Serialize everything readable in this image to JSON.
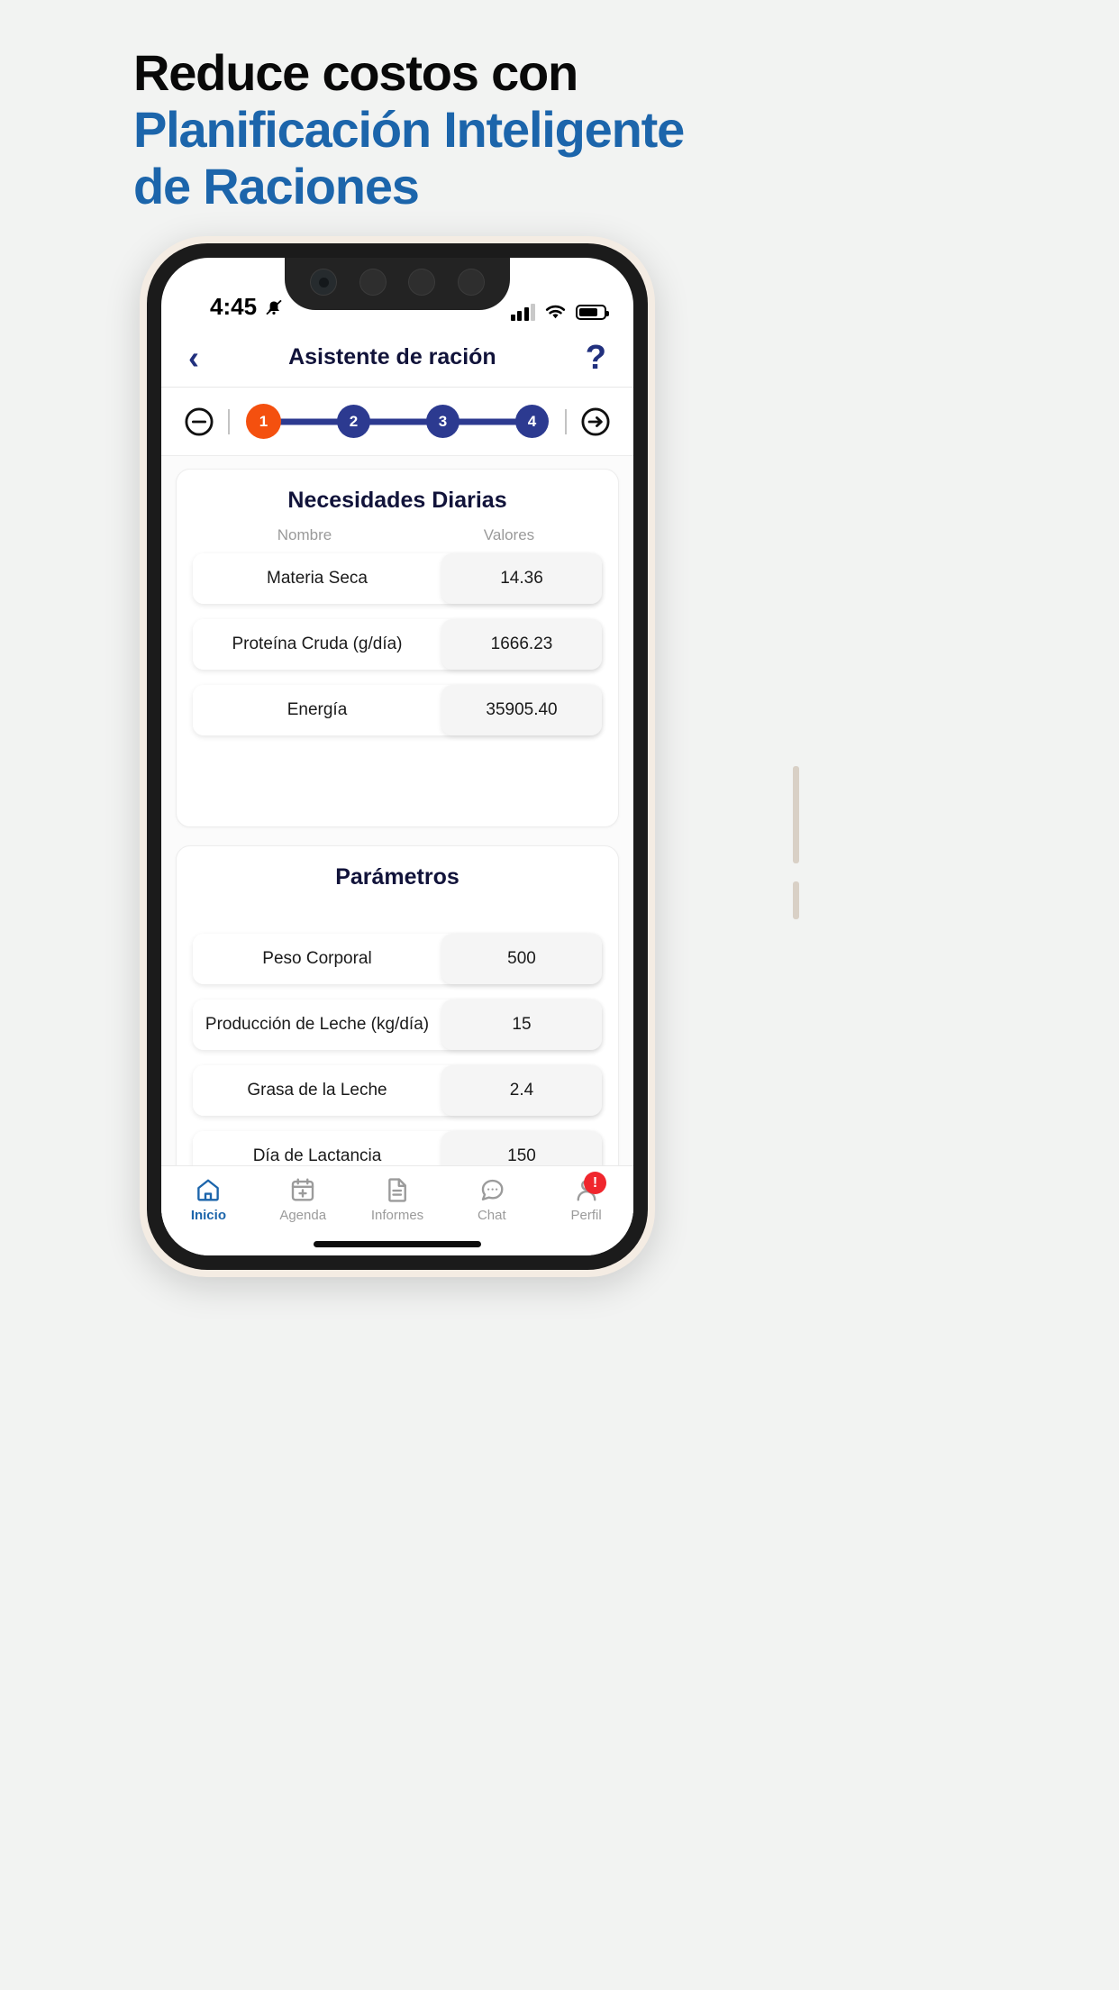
{
  "headline": {
    "line1": "Reduce costos con",
    "line2": "Planificación Inteligente",
    "line3": "de Raciones",
    "color_dark": "#090909",
    "color_accent": "#1c65ab"
  },
  "status_bar": {
    "time": "4:45",
    "silent_icon": "bell-muted-icon",
    "signal_icon": "signal-bars-icon",
    "wifi_icon": "wifi-icon",
    "battery_icon": "battery-icon"
  },
  "app_header": {
    "back_icon": "chevron-left-icon",
    "title": "Asistente de ración",
    "help_icon": "question-mark-icon",
    "title_color": "#11133a"
  },
  "stepper": {
    "minus_icon": "minus-circle-icon",
    "next_icon": "arrow-right-circle-icon",
    "active_color": "#f4500f",
    "step_color": "#2c3a90",
    "steps": [
      {
        "label": "1",
        "active": true
      },
      {
        "label": "2",
        "active": false
      },
      {
        "label": "3",
        "active": false
      },
      {
        "label": "4",
        "active": false
      }
    ]
  },
  "needs_card": {
    "title": "Necesidades Diarias",
    "col_name": "Nombre",
    "col_value": "Valores",
    "rows": [
      {
        "label": "Materia Seca",
        "value": "14.36"
      },
      {
        "label": "Proteína Cruda (g/día)",
        "value": "1666.23"
      },
      {
        "label": "Energía",
        "value": "35905.40"
      }
    ]
  },
  "params_card": {
    "title": "Parámetros",
    "rows": [
      {
        "label": "Peso Corporal",
        "value": "500"
      },
      {
        "label": "Producción de Leche (kg/día)",
        "value": "15"
      },
      {
        "label": "Grasa de la Leche",
        "value": "2.4"
      },
      {
        "label": "Día de Lactancia",
        "value": "150"
      }
    ]
  },
  "bottom_nav": {
    "items": [
      {
        "label": "Inicio",
        "icon": "home-icon",
        "active": true
      },
      {
        "label": "Agenda",
        "icon": "calendar-plus-icon",
        "active": false
      },
      {
        "label": "Informes",
        "icon": "document-icon",
        "active": false
      },
      {
        "label": "Chat",
        "icon": "chat-bubble-icon",
        "active": false
      },
      {
        "label": "Perfil",
        "icon": "person-icon",
        "active": false,
        "badge": "!"
      }
    ],
    "active_color": "#1c65ab",
    "inactive_color": "#9b9b9b",
    "badge_color": "#f0262d"
  }
}
